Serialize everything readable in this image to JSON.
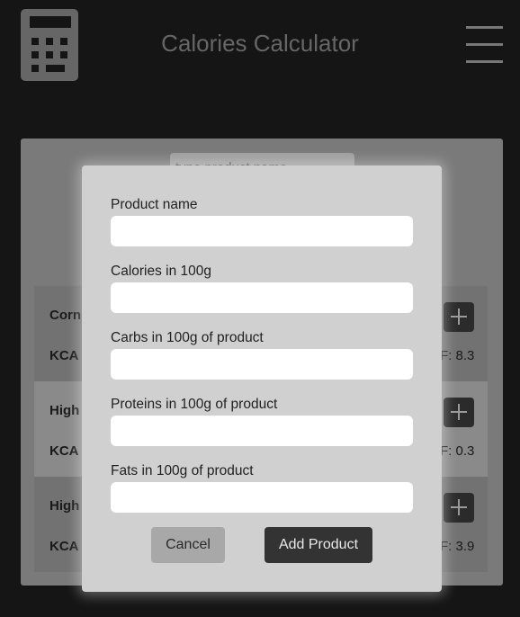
{
  "header": {
    "title": "Calories Calculator",
    "calc_icon": "calculator-icon",
    "menu_icon": "hamburger-menu-icon"
  },
  "background": {
    "search_placeholder": "type product name",
    "products": [
      {
        "name": "Corn",
        "kcal_label": "KCA",
        "fat_label": "F: 8.3"
      },
      {
        "name": "High",
        "kcal_label": "KCA",
        "fat_label": "F: 0.3"
      },
      {
        "name": "High",
        "kcal_label": "KCA",
        "fat_label": "F: 3.9"
      }
    ]
  },
  "modal": {
    "fields": [
      {
        "label": "Product name",
        "value": ""
      },
      {
        "label": "Calories in 100g",
        "value": ""
      },
      {
        "label": "Carbs in 100g of product",
        "value": ""
      },
      {
        "label": "Proteins in 100g of product",
        "value": ""
      },
      {
        "label": "Fats in 100g of product",
        "value": ""
      }
    ],
    "cancel_label": "Cancel",
    "add_label": "Add Product"
  },
  "colors": {
    "page_bg": "#151515",
    "modal_bg": "#d0d0d0",
    "primary_button": "#333333",
    "secondary_button": "#a8a8a8"
  }
}
